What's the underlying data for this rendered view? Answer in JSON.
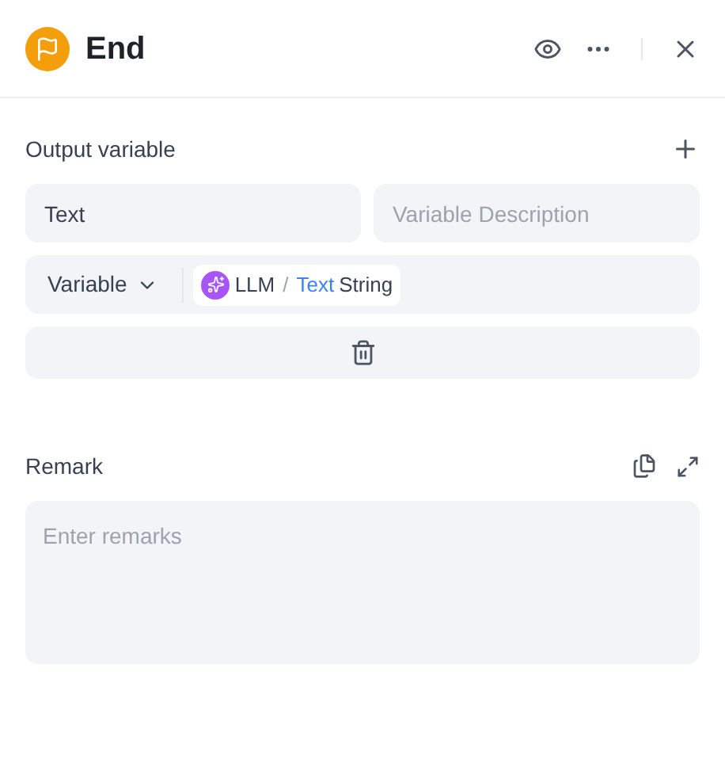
{
  "header": {
    "title": "End"
  },
  "output": {
    "label": "Output variable",
    "name": "Text",
    "description_placeholder": "Variable Description",
    "type_select": "Variable",
    "source": {
      "node": "LLM",
      "separator": "/",
      "field": "Text",
      "type": "String"
    }
  },
  "remark": {
    "label": "Remark",
    "placeholder": "Enter remarks"
  }
}
